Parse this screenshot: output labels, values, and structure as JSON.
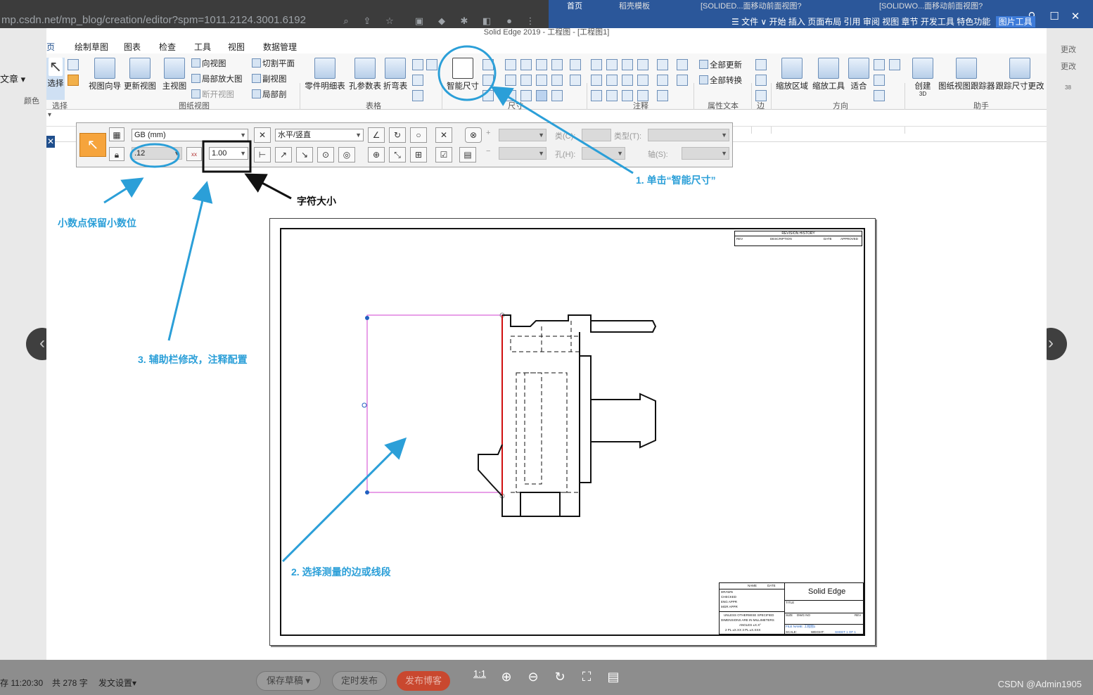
{
  "browser": {
    "url": "mp.csdn.net/mp_blog/creation/editor?spm=1011.2124.3001.6192",
    "editor_menu_label": "文章",
    "editor_color_label": "颜色",
    "status_time": "存 11:20:30",
    "word_count": "共 278 字",
    "publish_settings": "发文设置",
    "save_draft": "保存草稿",
    "schedule_publish": "定时发布",
    "publish_blog": "发布博客"
  },
  "word": {
    "tabs": [
      "首页",
      "稻壳模板",
      "[SOLIDED...面移动前面视图?",
      "[SOLIDWO...面移动前面视图?"
    ],
    "menu": "☰ 文件 ∨   开始  插入  页面布局  引用  审阅  视图  章节  开发工具  特色功能",
    "picture_tools": "图片工具",
    "side_rows": [
      "更改",
      "更改",
      "38"
    ]
  },
  "viewer": {
    "zoom_one": "1:1",
    "watermark": "CSDN @Admin1905"
  },
  "solidedge": {
    "title": "Solid Edge 2019 - 工程图 - [工程图1]",
    "tabs": [
      "页",
      "绘制草图",
      "图表",
      "检查",
      "工具",
      "视图",
      "数据管理"
    ],
    "ribbon": {
      "select": "选择",
      "view_wizard": "视图向导",
      "update_view": "更新视图",
      "principal_view": "主视图",
      "dir_view": "向视图",
      "detail_view": "局部放大图",
      "broken_view": "断开视图",
      "cut_plane": "切割平面",
      "aux_view": "副视图",
      "section": "局部剖",
      "parts_list": "零件明细表",
      "hole_table": "孔参数表",
      "bend_table": "折弯表",
      "smart_dimension": "智能尺寸",
      "update_all": "全部更新",
      "convert_all": "全部转换",
      "zoom_area": "缩放区域",
      "zoom_tool": "缩放工具",
      "fit": "适合",
      "create_3d": "创建",
      "create_3d_sub": "3D",
      "view_tracker": "图纸视图跟踪器",
      "dim_track": "跟踪尺寸更改",
      "groups": {
        "select": "选择",
        "drawing_views": "图纸视图",
        "tables": "表格",
        "dimension": "尺寸",
        "annotation": "注释",
        "property_text": "属性文本",
        "edge": "边",
        "orient": "方向",
        "assist": "助手"
      }
    },
    "cmdbar": {
      "standard": "GB (mm)",
      "decimal": ".12",
      "char_size": "1.00",
      "orientation": "水平/竖直",
      "type_label": "类(C):",
      "kind_label": "类型(T):",
      "hole_label": "孔(H):",
      "axis_label": "轴(S):"
    }
  },
  "annotations": {
    "step1": "1. 单击“智能尺寸”",
    "step2": "2. 选择测量的边或线段",
    "step3": "3. 辅助栏修改，注释配置",
    "decimal": "小数点保留小数位",
    "char_size": "字符大小"
  },
  "sheet": {
    "rev_header": "REVISION HISTORY",
    "rev_cols": [
      "REV",
      "DESCRIPTION",
      "DATE",
      "APPROVED"
    ],
    "brand": "Solid Edge",
    "tb_labels": [
      "NAME",
      "DATE",
      "DRAWN",
      "CHECKED",
      "ENG APPR",
      "MGR APPR",
      "UNLESS OTHERWISE SPECIFIED",
      "DIMENSIONS ARE IN MILLIMETERS",
      "ANGLES ±X.X°",
      "2 PL ±X.XX  3 PL ±X.XXX",
      "TITLE",
      "SIZE",
      "DWG NO",
      "REV",
      "FILE NAME: 工程图1",
      "SCALE:",
      "WEIGHT:",
      "SHEET 1 OF 1"
    ]
  },
  "colors": {
    "annotation_blue": "#2b9fd8",
    "selection_magenta": "#d040d0",
    "edge_red": "#d01010",
    "select_orange": "#f6a43c"
  }
}
